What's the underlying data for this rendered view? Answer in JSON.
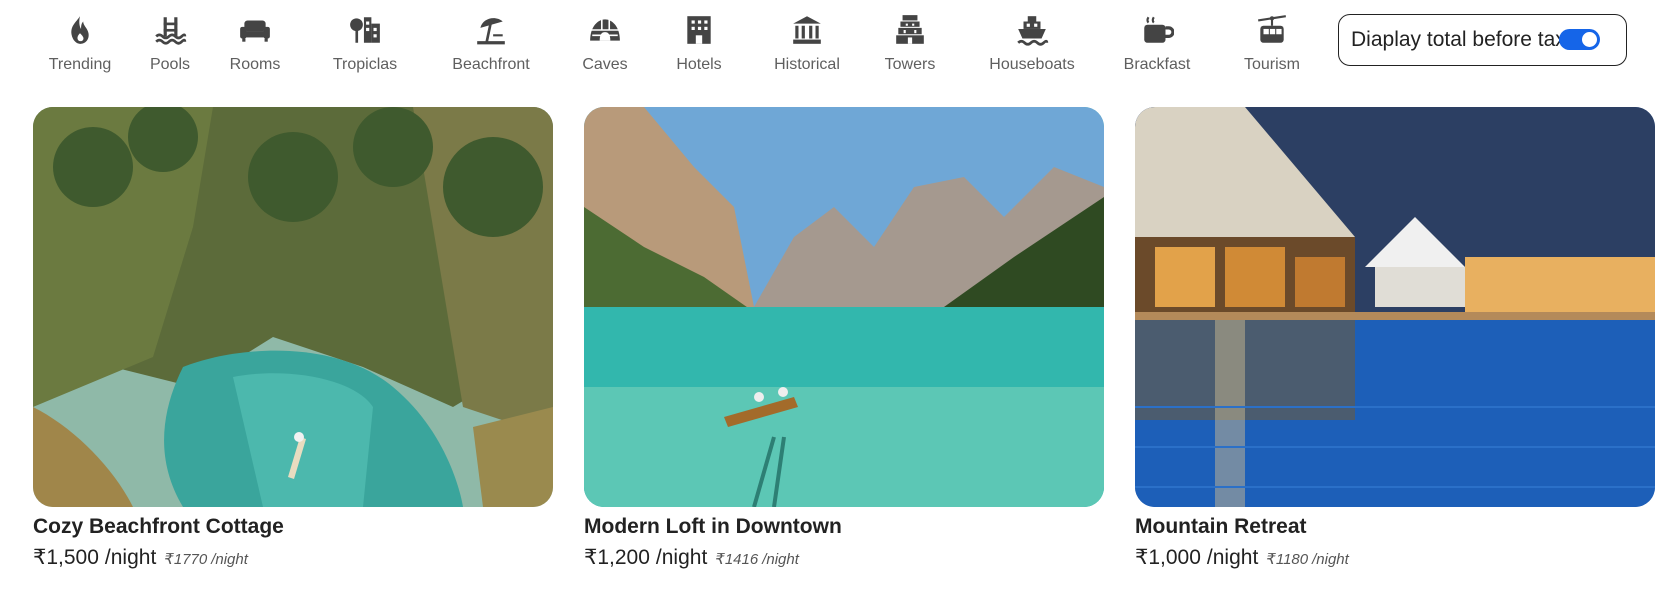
{
  "categories": [
    {
      "label": "Trending",
      "icon": "flame-icon"
    },
    {
      "label": "Pools",
      "icon": "pool-icon"
    },
    {
      "label": "Rooms",
      "icon": "sofa-icon"
    },
    {
      "label": "Tropiclas",
      "icon": "trees-icon"
    },
    {
      "label": "Beachfront",
      "icon": "umbrella-beach-icon"
    },
    {
      "label": "Caves",
      "icon": "igloo-icon"
    },
    {
      "label": "Hotels",
      "icon": "hotel-icon"
    },
    {
      "label": "Historical",
      "icon": "landmark-icon"
    },
    {
      "label": "Towers",
      "icon": "gopuram-icon"
    },
    {
      "label": "Houseboats",
      "icon": "ship-icon"
    },
    {
      "label": "Brackfast",
      "icon": "coffee-mug-icon"
    },
    {
      "label": "Tourism",
      "icon": "cable-car-icon"
    }
  ],
  "tax_toggle": {
    "label": "Diaplay total before tax",
    "enabled": true,
    "accent": "#1565e8"
  },
  "listings": [
    {
      "title": "Cozy Beachfront Cottage",
      "price": "₹1,500",
      "per": "/night",
      "price_with_tax": "₹1770",
      "per_tax": "/night",
      "image": "tropical river with palm trees and a canoe"
    },
    {
      "title": "Modern Loft in Downtown",
      "price": "₹1,200",
      "per": "/night",
      "price_with_tax": "₹1416",
      "per_tax": "/night",
      "image": "turquoise mountain lake with rowing boat"
    },
    {
      "title": "Mountain Retreat",
      "price": "₹1,000",
      "per": "/night",
      "price_with_tax": "₹1180",
      "per_tax": "/night",
      "image": "resort pool at dusk with restaurant"
    }
  ]
}
